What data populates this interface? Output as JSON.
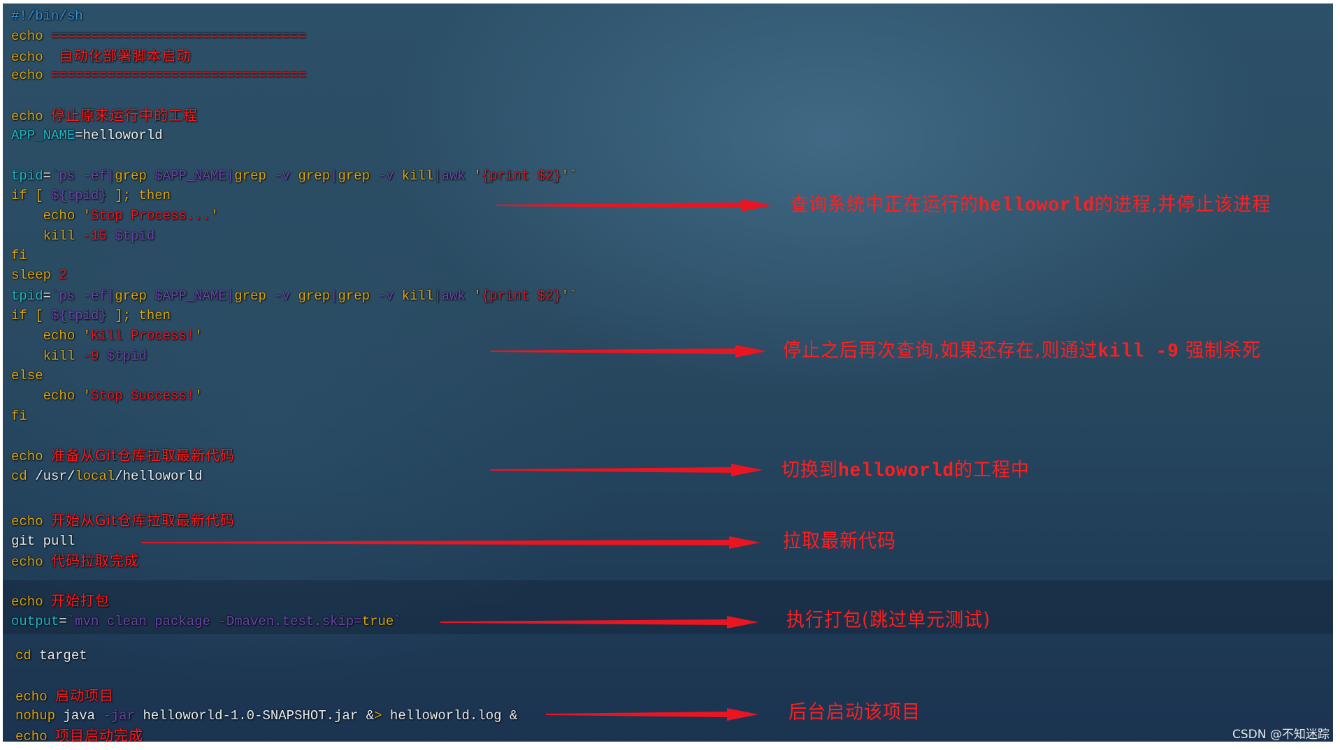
{
  "theme": {
    "accent_red": "#e8141e",
    "keyword_gold": "#d9a30f",
    "variable_cyan": "#1fb6c6",
    "substitution_purple": "#6b44a6",
    "background_navy": "#22405a"
  },
  "code": {
    "shebang": "#!/bin/sh",
    "lines": {
      "l1": {
        "kw": "echo",
        "rest": " ================================"
      },
      "l2": {
        "kw": "echo",
        "cn": "自动化部署脚本启动"
      },
      "l3": {
        "kw": "echo",
        "rest": " ================================"
      },
      "l4": {
        "kw": "echo",
        "cn": "停止原来运行中的工程"
      },
      "l5": {
        "var": "APP_NAME",
        "rest": "=helloworld"
      },
      "l6": {
        "var": "tpid",
        "eq": "=",
        "p1": "`ps -ef|",
        "grep1": "grep",
        "p2": " $APP_NAME|",
        "grep2": "grep",
        "p3": " -v ",
        "grep3": "grep",
        "pipe": "|",
        "grep4": "grep",
        "p4": " -v ",
        "kill": "kill",
        "p5": "|awk ",
        "q1": "'",
        "print": "{print $2}",
        "q2": "'`"
      },
      "l7": {
        "kw_if": "if [",
        "sub": " ${tpid}",
        "kw_then": " ]; then"
      },
      "l8": {
        "indent": "    ",
        "kw": "echo",
        "q1": " '",
        "str": "Stop Process...",
        "q2": "'"
      },
      "l9": {
        "indent": "    ",
        "kw": "kill",
        "num": " -15",
        "sub": " $tpid"
      },
      "l10": {
        "kw": "fi"
      },
      "l11": {
        "kw": "sleep",
        "num": " 2"
      },
      "l12": {
        "var": "tpid",
        "eq": "=",
        "p1": "`ps -ef|",
        "grep1": "grep",
        "p2": " $APP_NAME|",
        "grep2": "grep",
        "p3": " -v ",
        "grep3": "grep",
        "pipe": "|",
        "grep4": "grep",
        "p4": " -v ",
        "kill": "kill",
        "p5": "|awk ",
        "q1": "'",
        "print": "{print $2}",
        "q2": "'`"
      },
      "l13": {
        "kw_if": "if [",
        "sub": " ${tpid}",
        "kw_then": " ]; then"
      },
      "l14": {
        "indent": "    ",
        "kw": "echo",
        "q1": " '",
        "str": "Kill Process!",
        "q2": "'"
      },
      "l15": {
        "indent": "    ",
        "kw": "kill",
        "num": " -9",
        "sub": " $tpid"
      },
      "l16": {
        "kw": "else"
      },
      "l17": {
        "indent": "    ",
        "kw": "echo",
        "q1": " '",
        "str": "Stop Success!",
        "q2": "'"
      },
      "l18": {
        "kw": "fi"
      },
      "l19": {
        "kw": "echo",
        "cn": "准备从Git仓库拉取最新代码"
      },
      "l20": {
        "kw": "cd",
        "p1": " /usr/",
        "local": "local",
        "p2": "/helloworld"
      },
      "l21": {
        "kw": "echo",
        "cn": "开始从Git仓库拉取最新代码"
      },
      "l22": {
        "plain": "git pull"
      },
      "l23": {
        "kw": "echo",
        "cn": "代码拉取完成"
      },
      "l24": {
        "kw": "echo",
        "cn": "开始打包"
      },
      "l25": {
        "var": "output",
        "eq": "=",
        "sub": "`mvn clean package -Dmaven.test.skip=",
        "kw": "true",
        "tick": "`"
      },
      "l26": {
        "kw": "cd",
        "plain": " target"
      },
      "l27": {
        "kw": "echo",
        "cn": "启动项目"
      },
      "l28": {
        "kw": "nohup",
        "p1": " java ",
        "sub": "-jar",
        "p2": " helloworld-1.0-SNAPSHOT.jar ",
        "amp": "&",
        "gt": ">",
        "p3": " helloworld.log &"
      },
      "l29": {
        "kw": "echo",
        "cn": "项目启动完成"
      }
    }
  },
  "annotations": [
    {
      "pre": "查询系统中正在运行的",
      "mono": "helloworld",
      "post": "的进程,并停止该进程"
    },
    {
      "pre": "停止之后再次查询,如果还存在,则通过",
      "mono": "kill -9",
      "post": " 强制杀死"
    },
    {
      "pre": "切换到",
      "mono": "helloworld",
      "post": "的工程中"
    },
    {
      "pre": "拉取最新代码",
      "mono": "",
      "post": ""
    },
    {
      "pre": "执行打包(跳过单元测试)",
      "mono": "",
      "post": ""
    },
    {
      "pre": "后台启动该项目",
      "mono": "",
      "post": ""
    }
  ],
  "watermark": "CSDN @不知迷踪"
}
